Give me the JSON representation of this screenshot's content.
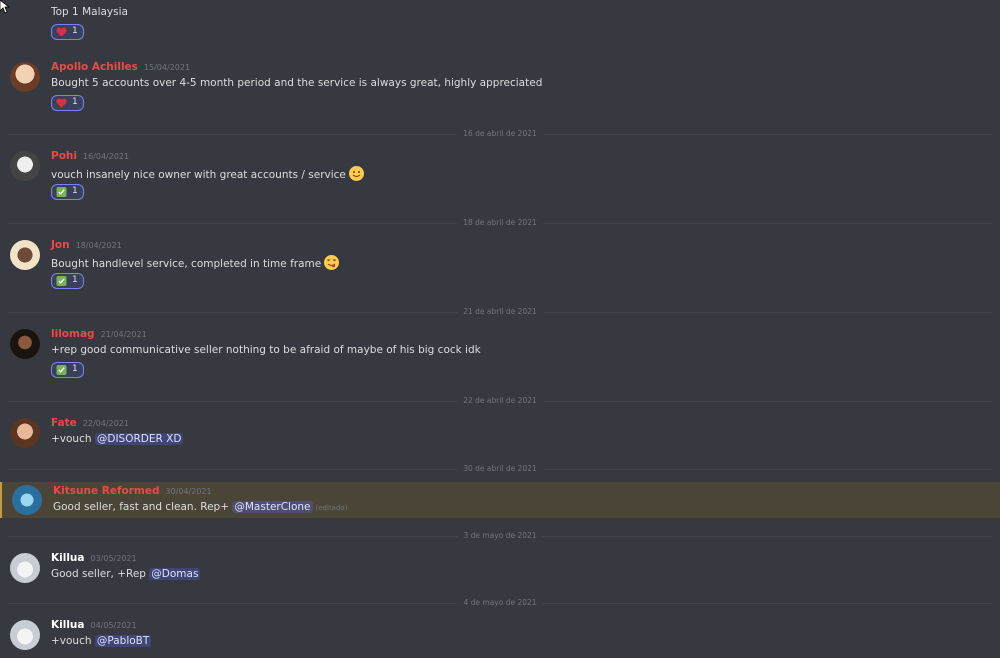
{
  "messages": [
    {
      "author": "",
      "timestamp": "",
      "content": "Top 1 Malaysia",
      "reaction": {
        "emoji": "heart",
        "count": "1"
      }
    },
    {
      "author": "Apollo Achilles",
      "timestamp": "15/04/2021",
      "content": "Bought 5 accounts over 4-5 month period and the service is always great, highly appreciated",
      "reaction": {
        "emoji": "heart",
        "count": "1"
      }
    },
    {
      "author": "Pohi",
      "timestamp": "16/04/2021",
      "content": "vouch insanely nice owner with great accounts / service",
      "inline_emoji": "slightly-smiling-face",
      "reaction": {
        "emoji": "white-check-mark",
        "count": "1"
      }
    },
    {
      "author": "Jon",
      "timestamp": "18/04/2021",
      "content": "Bought handlevel service, completed in time frame",
      "inline_emoji": "face-savoring-food",
      "reaction": {
        "emoji": "white-check-mark",
        "count": "1"
      }
    },
    {
      "author": "lilomag",
      "timestamp": "21/04/2021",
      "content": "+rep good communicative seller nothing to be afraid of maybe of his big cock idk",
      "reaction": {
        "emoji": "white-check-mark",
        "count": "1"
      }
    },
    {
      "author": "Fate",
      "timestamp": "22/04/2021",
      "content": "+vouch",
      "mention": "@DISORDER XD"
    },
    {
      "author": "Kitsune Reformed",
      "timestamp": "30/04/2021",
      "content": "Good seller, fast and clean. Rep+",
      "mention": "@MasterClone",
      "edited": "(editado)"
    },
    {
      "author": "Killua",
      "timestamp": "03/05/2021",
      "content": "Good seller, +Rep",
      "mention": "@Domas"
    },
    {
      "author": "Killua",
      "timestamp": "04/05/2021",
      "content": "+vouch",
      "mention": "@PabloBT"
    }
  ],
  "dividers": [
    "16 de abril de 2021",
    "18 de abril de 2021",
    "21 de abril de 2021",
    "22 de abril de 2021",
    "30 de abril de 2021",
    "3 de mayo de 2021",
    "4 de mayo de 2021"
  ],
  "colors": {
    "background": "#36393f",
    "author_red": "#f04747",
    "mention_bg": "#3c4270",
    "highlight_bg": "#4a4536",
    "reaction_border": "#7983f5"
  }
}
